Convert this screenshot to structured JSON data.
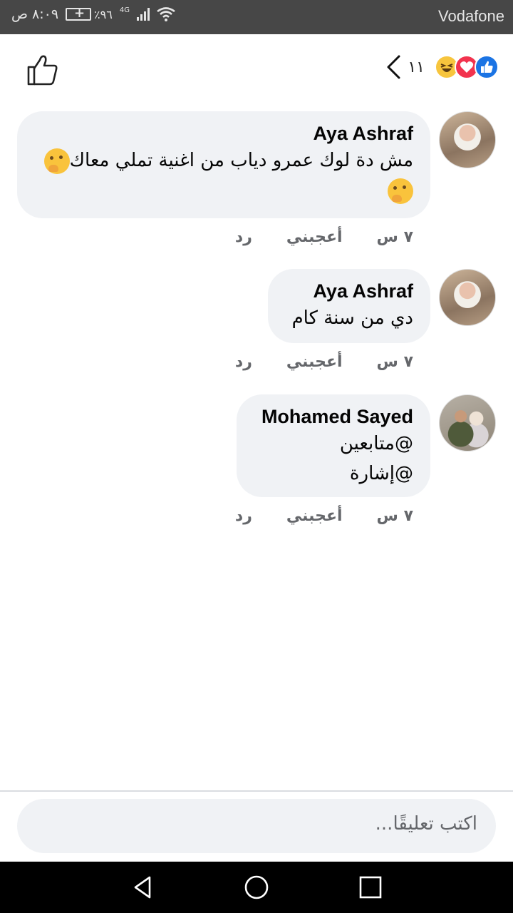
{
  "status_bar": {
    "carrier": "Vodafone",
    "time": "٨:٠٩ ص",
    "battery": "٪٩٦",
    "network": "4G"
  },
  "header": {
    "reaction_count": "١١",
    "reaction_icons": [
      "like-icon",
      "love-icon",
      "haha-icon"
    ],
    "like_button_icon": "thumbs-up-outline-icon",
    "back_icon": "chevron-left-icon"
  },
  "comments": [
    {
      "author": "Aya Ashraf",
      "text_line1": "مش دة لوك عمرو دياب من اغنية تملي معاك",
      "emoji": "thinking-face-icon",
      "time": "٧ س",
      "like_label": "أعجبني",
      "reply_label": "رد"
    },
    {
      "author": "Aya Ashraf",
      "text_line1": "دي من سنة كام",
      "time": "٧ س",
      "like_label": "أعجبني",
      "reply_label": "رد"
    },
    {
      "author": "Mohamed Sayed",
      "text_line1": "@متابعين",
      "text_line2": "@إشارة",
      "time": "٧ س",
      "like_label": "أعجبني",
      "reply_label": "رد"
    }
  ],
  "composer": {
    "placeholder": "اكتب تعليقًا..."
  },
  "nav_bar": {
    "icons": [
      "back-triangle-icon",
      "home-circle-icon",
      "recents-square-icon"
    ]
  }
}
